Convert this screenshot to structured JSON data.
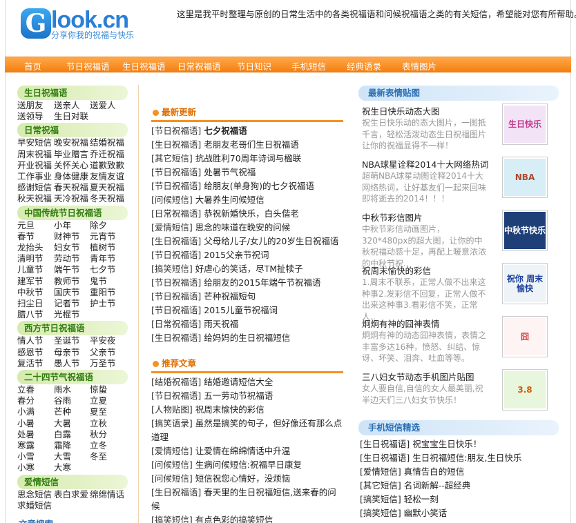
{
  "header": {
    "logo_text": "Glook.cn",
    "logo_letter": "G",
    "logo_rest": "look.cn",
    "logo_sub": "分享你我的祝福与快乐",
    "tagline": "这里是我平时整理与原创的日常生活中的各类祝福语和问候祝福语之类的有关短信，希望能对您有所帮助。"
  },
  "nav": [
    "首页",
    "节日祝福语",
    "生日祝福语",
    "日常祝福语",
    "节日知识",
    "手机短信",
    "经典语录",
    "表情图片"
  ],
  "left": {
    "categories": [
      {
        "title": "生日祝福语",
        "links": [
          "送朋友",
          "送亲人",
          "送爱人",
          "送领导",
          "生日对联"
        ]
      },
      {
        "title": "日常祝福",
        "links": [
          "早安短信",
          "晚安祝福",
          "结婚祝福",
          "周末祝福",
          "毕业赠言",
          "乔迁祝福",
          "开业祝福",
          "关怀关心",
          "道歉致歉",
          "工作事业",
          "身体健康",
          "友情友谊",
          "感谢短信",
          "春天祝福",
          "夏天祝福",
          "秋天祝福",
          "天冷祝福",
          "冬天祝福"
        ]
      },
      {
        "title": "中国传统节日祝福语",
        "links": [
          "元旦",
          "小年",
          "除夕",
          "春节",
          "财神节",
          "元宵节",
          "龙抬头",
          "妇女节",
          "植树节",
          "清明节",
          "劳动节",
          "青年节",
          "儿童节",
          "端午节",
          "七夕节",
          "建军节",
          "教师节",
          "鬼节",
          "中秋节",
          "国庆节",
          "重阳节",
          "扫尘日",
          "记者节",
          "护士节",
          "腊八节",
          "光棍节"
        ]
      },
      {
        "title": "西方节日祝福语",
        "links": [
          "情人节",
          "圣诞节",
          "平安夜",
          "感恩节",
          "母亲节",
          "父亲节",
          "复活节",
          "愚人节",
          "万圣节"
        ]
      },
      {
        "title": "二十四节气祝福语",
        "links": [
          "立春",
          "雨水",
          "惊蛰",
          "春分",
          "谷雨",
          "立夏",
          "小满",
          "芒种",
          "夏至",
          "小暑",
          "大暑",
          "立秋",
          "处暑",
          "白露",
          "秋分",
          "寒露",
          "霜降",
          "立冬",
          "小雪",
          "大雪",
          "冬至",
          "小寒",
          "大寒"
        ]
      },
      {
        "title": "爱情短信",
        "links": [
          "思念短信",
          "表白求爱",
          "绵绵情话",
          "求婚短信"
        ]
      }
    ],
    "search_title": "文章搜索"
  },
  "main": {
    "latest_title": "最新更新",
    "latest": [
      {
        "cat": "[节日祝福语]",
        "title": "七夕祝福语"
      },
      {
        "cat": "[生日祝福语]",
        "title": "老朋友老哥们生日祝福语"
      },
      {
        "cat": "[其它短信]",
        "title": "抗战胜利70周年诗词与楹联"
      },
      {
        "cat": "[节日祝福语]",
        "title": "处暑节气祝福"
      },
      {
        "cat": "[节日祝福语]",
        "title": "给朋友(单身狗)的七夕祝福语"
      },
      {
        "cat": "[问候短信]",
        "title": "大暑养生问候短信"
      },
      {
        "cat": "[日常祝福语]",
        "title": "恭祝新婚快乐，白头偕老"
      },
      {
        "cat": "[爱情短信]",
        "title": "思念的味道在晚安的问候"
      },
      {
        "cat": "[生日祝福语]",
        "title": "父母给儿子/女儿的20岁生日祝福语"
      },
      {
        "cat": "[节日祝福语]",
        "title": "2015父亲节祝词"
      },
      {
        "cat": "[搞笑短信]",
        "title": "好虐心的笑话，尽TM扯犊子"
      },
      {
        "cat": "[节日祝福语]",
        "title": "给朋友的2015年端午节祝福语"
      },
      {
        "cat": "[节日祝福语]",
        "title": "芒种祝福短句"
      },
      {
        "cat": "[节日祝福语]",
        "title": "2015儿童节祝福词"
      },
      {
        "cat": "[日常祝福语]",
        "title": "雨天祝福"
      },
      {
        "cat": "[生日祝福语]",
        "title": "给妈妈的生日祝福短信"
      }
    ],
    "recommend_title": "推荐文章",
    "recommend": [
      {
        "cat": "[结婚祝福语]",
        "title": "结婚邀请短信大全"
      },
      {
        "cat": "[节日祝福语]",
        "title": "五一劳动节祝福语"
      },
      {
        "cat": "[人物贴图]",
        "title": "祝周末愉快的彩信"
      },
      {
        "cat": "[搞笑语录]",
        "title": "虽然是搞笑的句子，但好像还有那么点道理"
      },
      {
        "cat": "[爱情短信]",
        "title": "让爱情在绵绵情话中升温"
      },
      {
        "cat": "[问候短信]",
        "title": "生病问候短信:祝福早日康复"
      },
      {
        "cat": "[问候短信]",
        "title": "短信祝您心情好，没烦恼"
      },
      {
        "cat": "[生日祝福语]",
        "title": "春天里的生日祝福短信,送来春的问候"
      },
      {
        "cat": "[搞笑短信]",
        "title": "有点色彩的搞笑短信"
      }
    ]
  },
  "right": {
    "pics_title": "最新表情贴图",
    "pics": [
      {
        "title": "祝生日快乐动态大图",
        "desc": "祝生日快乐动的态大图片，一图抵千言，轻松活泼动态生日祝福图片让你的祝福显得不一样！",
        "thumb": "生日快乐",
        "thumb_bg": "#f3e3f7",
        "thumb_fg": "#c13b8b"
      },
      {
        "title": "NBA球星诠释2014十大网络热词",
        "desc": "超萌NBA球星动图诠释2014十大网络热词，让好基友们一起来回味即将逝去的2014！！！",
        "thumb": "NBA",
        "thumb_bg": "#d7eef7",
        "thumb_fg": "#b0472c"
      },
      {
        "title": "中秋节彩信图片",
        "desc": "中秋节彩信动画图片，320*480px的超大图，让你的中秋祝福动感十足，再配上暖意浓浓的中秋节祝..",
        "thumb": "中秋节快乐",
        "thumb_bg": "#1e3f78",
        "thumb_fg": "#ffffff"
      },
      {
        "title": "祝周末愉快的彩信",
        "desc": "1.周末不联系，正常人做不出来这种事2.发彩信不回复，正常人做不出来这种事3.看彩信不笑，正常人..",
        "thumb": "祝你 周末愉快",
        "thumb_bg": "#eef3f7",
        "thumb_fg": "#1b3f9a"
      },
      {
        "title": "炯炯有神的囧神表情",
        "desc": "炯炯有神的动态囧神表情，表情之丰富多达16种，愤怒、纠结、惊讶、坏笑、泪奔、吐血等等。",
        "thumb": "囧",
        "thumb_bg": "#fff4f4",
        "thumb_fg": "#d23a3a"
      },
      {
        "title": "三八妇女节动态手机图片贴图",
        "desc": "女人要自信,自信的女人最美丽,祝半边天们三八妇女节快乐！",
        "thumb": "3.8",
        "thumb_bg": "#e7f6dd",
        "thumb_fg": "#d45a0a"
      }
    ],
    "sms_title": "手机短信精选",
    "sms": [
      {
        "cat": "[生日祝福语]",
        "title": "祝宝宝生日快乐！"
      },
      {
        "cat": "[生日祝福语]",
        "title": "生日祝福短信:朋友,生日快乐"
      },
      {
        "cat": "[爱情短信]",
        "title": "真情告白的短信"
      },
      {
        "cat": "[其它短信]",
        "title": "名词新解--超经典"
      },
      {
        "cat": "[搞笑短信]",
        "title": "轻松一刻"
      },
      {
        "cat": "[搞笑短信]",
        "title": "幽默小笑话"
      }
    ]
  },
  "colors": {
    "nav": "#f58a1a",
    "green_head": "#2f7d0f",
    "orange_head": "#e06f00",
    "blue_head": "#2a6fb5"
  }
}
